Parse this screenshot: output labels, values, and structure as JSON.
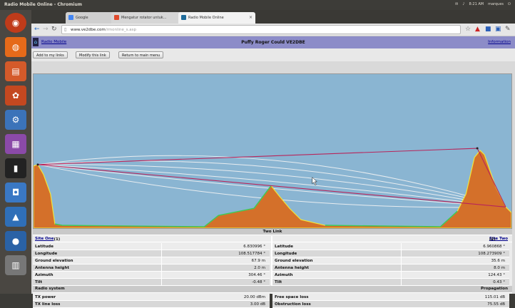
{
  "window": {
    "title": "Radio Mobile Online - Chromium",
    "clock": "8:21 AM",
    "user": "marques"
  },
  "tabs": [
    {
      "label": "Google",
      "active": false
    },
    {
      "label": "Mengatur rotator untuk...",
      "active": false
    },
    {
      "label": "Radio Mobile Online",
      "active": true
    }
  ],
  "url": {
    "host": "www.ve2dbe.com",
    "path": "/rmonline_s.asp"
  },
  "header": {
    "home_link": "Radio Mobile",
    "title": "Puffy Roger Could VE2DBE",
    "info_link": "Information"
  },
  "buttons": [
    "Add to my links",
    "Modify this link",
    "Return to main menu"
  ],
  "sections": {
    "link": "Two Link",
    "radio": "Radio system",
    "prop": "Propagation"
  },
  "site1": {
    "label": "Site One",
    "num": "(1)"
  },
  "site2": {
    "label": "Site Two",
    "num": "(2)"
  },
  "site_rows": [
    {
      "label": "Latitude",
      "v1": "6.830996 °",
      "v2": "6.960868 °"
    },
    {
      "label": "Longitude",
      "v1": "108.517784 °",
      "v2": "108.273909 °"
    },
    {
      "label": "Ground elevation",
      "v1": "67.9 m",
      "v2": "35.6 m"
    },
    {
      "label": "Antenna height",
      "v1": "2.0 m",
      "v2": "8.0 m"
    },
    {
      "label": "Azimuth",
      "v1": "304.46 °",
      "v2": "124.43 °"
    },
    {
      "label": "Tilt",
      "v1": "-0.48 °",
      "v2": "0.43 °"
    }
  ],
  "radio_rows": [
    {
      "label": "TX power",
      "value": "20.00 dBm"
    },
    {
      "label": "TX line loss",
      "value": "3.00 dB"
    }
  ],
  "prop_rows": [
    {
      "label": "Free space loss",
      "value": "115.01 dB"
    },
    {
      "label": "Obstruction loss",
      "value": "75.55 dB"
    }
  ],
  "colors": {
    "sky": "#8ab5d2",
    "terrain": "#d4702a",
    "fresnel": "#f2f2f2",
    "los": "#b8245a",
    "header": "#8c8cc8"
  },
  "icons": [
    "ubuntu-logo-icon",
    "firefox-icon",
    "files-icon",
    "software-center-icon",
    "settings-icon",
    "workspace-icon",
    "terminal-icon",
    "screenshot-icon",
    "launcher-app-icon",
    "terminal-app-icon",
    "trash-icon"
  ]
}
